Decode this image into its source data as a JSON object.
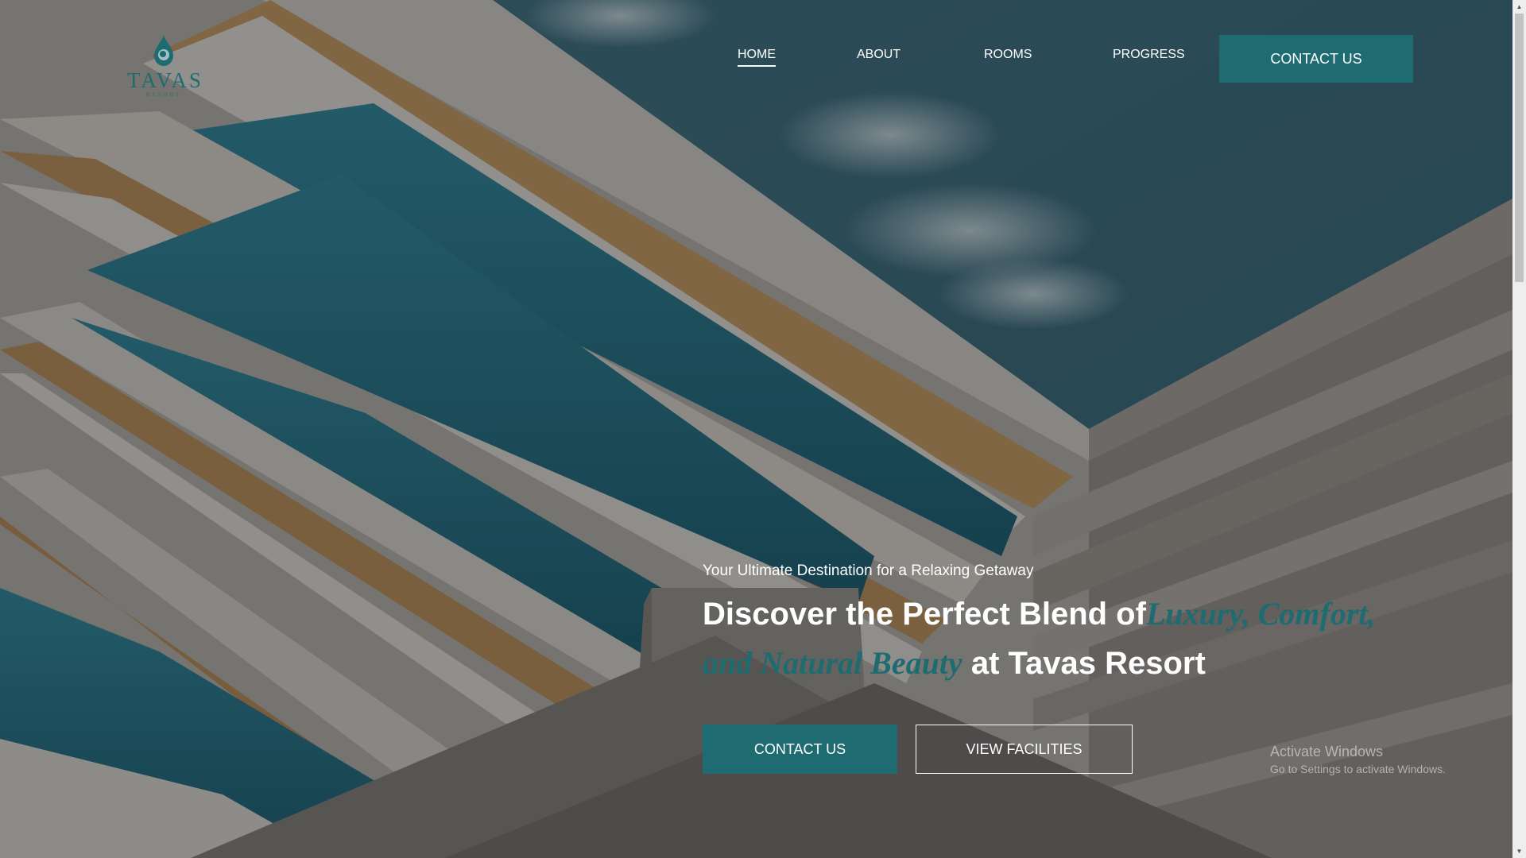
{
  "brand": {
    "name": "TAVAS",
    "tagline": "RESORT",
    "accent_color": "#1e6b72"
  },
  "nav": {
    "items": [
      {
        "label": "HOME",
        "active": true
      },
      {
        "label": "ABOUT",
        "active": false
      },
      {
        "label": "ROOMS",
        "active": false
      },
      {
        "label": "PROGRESS",
        "active": false
      }
    ],
    "contact_label": "CONTACT US"
  },
  "hero": {
    "tagline": "Your Ultimate Destination for a Relaxing Getaway",
    "title_before": "Discover the Perfect Blend of",
    "title_accent": "Luxury, Comfort, and Natural Beauty",
    "title_after": " at Tavas Resort",
    "primary_button": "CONTACT US",
    "secondary_button": "VIEW FACILITIES"
  },
  "system_watermark": {
    "title": "Activate Windows",
    "subtitle": "Go to Settings to activate Windows."
  }
}
